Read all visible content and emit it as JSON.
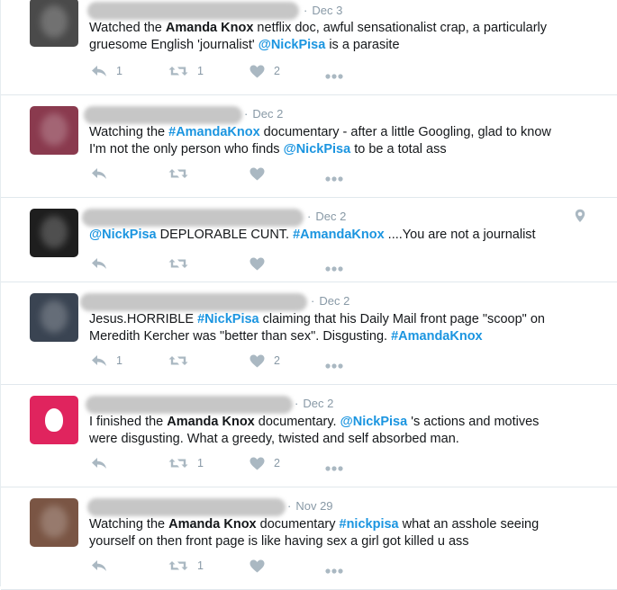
{
  "tweets": [
    {
      "date": "Dec 3",
      "avatar_color": "#4a4a4a",
      "line1": [
        {
          "t": "Watched the ",
          "s": "plain"
        },
        {
          "t": "Amanda Knox",
          "s": "bold"
        },
        {
          "t": " netflix doc, awful sensationalist crap, a particularly",
          "s": "plain"
        }
      ],
      "line2": [
        {
          "t": "gruesome English 'journalist' ",
          "s": "plain"
        },
        {
          "t": "@NickPisa",
          "s": "link"
        },
        {
          "t": " is a parasite",
          "s": "plain"
        }
      ],
      "replies": "1",
      "retweets": "1",
      "likes": "2"
    },
    {
      "date": "Dec 2",
      "avatar_color": "#8a3a4e",
      "line1": [
        {
          "t": "Watching the ",
          "s": "plain"
        },
        {
          "t": "#AmandaKnox",
          "s": "link"
        },
        {
          "t": " documentary - after a little Googling, glad to know",
          "s": "plain"
        }
      ],
      "line2": [
        {
          "t": "I'm not the only person who finds ",
          "s": "plain"
        },
        {
          "t": "@NickPisa",
          "s": "link"
        },
        {
          "t": " to be a total ass",
          "s": "plain"
        }
      ],
      "replies": "",
      "retweets": "",
      "likes": ""
    },
    {
      "date": "Dec 2",
      "avatar_color": "#1e1e1e",
      "line1": [
        {
          "t": "@NickPisa",
          "s": "link"
        },
        {
          "t": " DEPLORABLE CUNT. ",
          "s": "plain"
        },
        {
          "t": "#AmandaKnox",
          "s": "link"
        },
        {
          "t": " ....You are not a journalist",
          "s": "plain"
        }
      ],
      "line2": [],
      "replies": "",
      "retweets": "",
      "likes": ""
    },
    {
      "date": "Dec 2",
      "avatar_color": "#3a4452",
      "line1": [
        {
          "t": "Jesus.HORRIBLE ",
          "s": "plain"
        },
        {
          "t": "#NickPisa",
          "s": "link"
        },
        {
          "t": " claiming that his Daily Mail front page \"scoop\" on",
          "s": "plain"
        }
      ],
      "line2": [
        {
          "t": "Meredith Kercher was \"better than sex\". Disgusting. ",
          "s": "plain"
        },
        {
          "t": "#AmandaKnox",
          "s": "link"
        }
      ],
      "replies": "1",
      "retweets": "",
      "likes": "2"
    },
    {
      "date": "Dec 2",
      "avatar_color": "#e0245e",
      "line1": [
        {
          "t": "I finished the ",
          "s": "plain"
        },
        {
          "t": "Amanda Knox",
          "s": "bold"
        },
        {
          "t": " documentary. ",
          "s": "plain"
        },
        {
          "t": "@NickPisa",
          "s": "link"
        },
        {
          "t": " 's actions and motives",
          "s": "plain"
        }
      ],
      "line2": [
        {
          "t": "were disgusting. What a greedy, twisted and self absorbed man.",
          "s": "plain"
        }
      ],
      "replies": "",
      "retweets": "1",
      "likes": "2"
    },
    {
      "date": "Nov 29",
      "avatar_color": "#7a5544",
      "line1": [
        {
          "t": "Watching the ",
          "s": "plain"
        },
        {
          "t": "Amanda Knox",
          "s": "bold"
        },
        {
          "t": " documentary ",
          "s": "plain"
        },
        {
          "t": "#nickpisa",
          "s": "link"
        },
        {
          "t": " what an asshole seeing",
          "s": "plain"
        }
      ],
      "line2": [
        {
          "t": "yourself on then front page is like having sex a girl got killed u ass",
          "s": "plain"
        }
      ],
      "replies": "",
      "retweets": "1",
      "likes": ""
    }
  ],
  "icons": {
    "reply": "reply-icon",
    "retweet": "retweet-icon",
    "like": "heart-icon",
    "more": "more-icon",
    "location": "location-pin-icon"
  },
  "colors": {
    "link": "#1b95e0",
    "icon": "#aab8c2",
    "meta": "#8899a6"
  }
}
